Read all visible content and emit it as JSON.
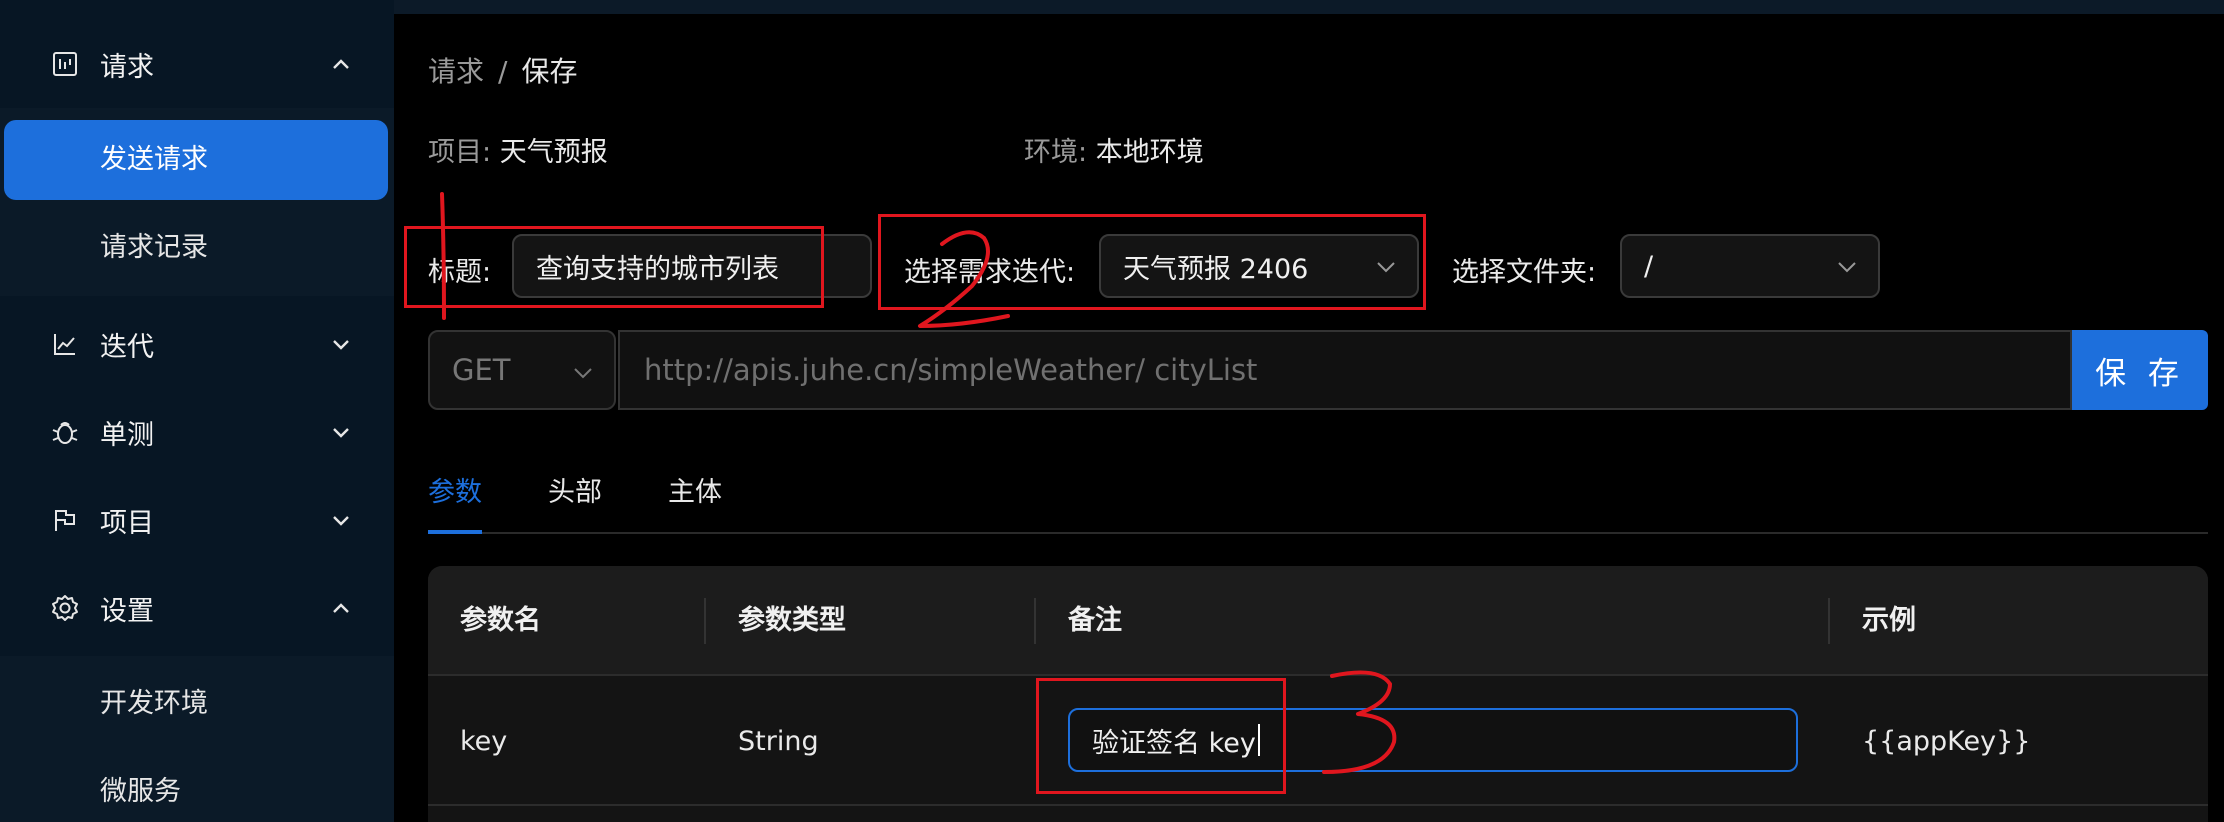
{
  "sidebar": {
    "groups": [
      {
        "label": "请求",
        "icon": "request-icon",
        "expanded": true
      },
      {
        "label": "迭代",
        "icon": "chart-line-icon",
        "expanded": false
      },
      {
        "label": "单测",
        "icon": "bug-icon",
        "expanded": false
      },
      {
        "label": "项目",
        "icon": "flag-icon",
        "expanded": false
      },
      {
        "label": "设置",
        "icon": "gear-icon",
        "expanded": true
      }
    ],
    "request_items": [
      "发送请求",
      "请求记录"
    ],
    "settings_items": [
      "开发环境",
      "微服务"
    ],
    "active_item": "发送请求"
  },
  "breadcrumb": {
    "parent": "请求",
    "separator": "/",
    "current": "保存"
  },
  "info": {
    "project_label": "项目:",
    "project_value": "天气预报",
    "env_label": "环境:",
    "env_value": "本地环境"
  },
  "form": {
    "title_label": "标题:",
    "title_value": "查询支持的城市列表",
    "iteration_label": "选择需求迭代:",
    "iteration_value": "天气预报 2406",
    "folder_label": "选择文件夹:",
    "folder_value": "/"
  },
  "request": {
    "method": "GET",
    "url_placeholder": "http://apis.juhe.cn/simpleWeather/ cityList",
    "save_label": "保 存"
  },
  "tabs": [
    {
      "label": "参数",
      "active": true
    },
    {
      "label": "头部",
      "active": false
    },
    {
      "label": "主体",
      "active": false
    }
  ],
  "params_table": {
    "headers": [
      "参数名",
      "参数类型",
      "备注",
      "示例"
    ],
    "rows": [
      {
        "name": "key",
        "type": "String",
        "remark": "验证签名 key",
        "example": "{{appKey}}"
      }
    ]
  },
  "annotations": {
    "marks": [
      "1",
      "2",
      "3"
    ],
    "color": "#e0161e"
  },
  "colors": {
    "accent": "#1d6fdc",
    "sidebar_bg": "#071624",
    "background": "#000000"
  }
}
